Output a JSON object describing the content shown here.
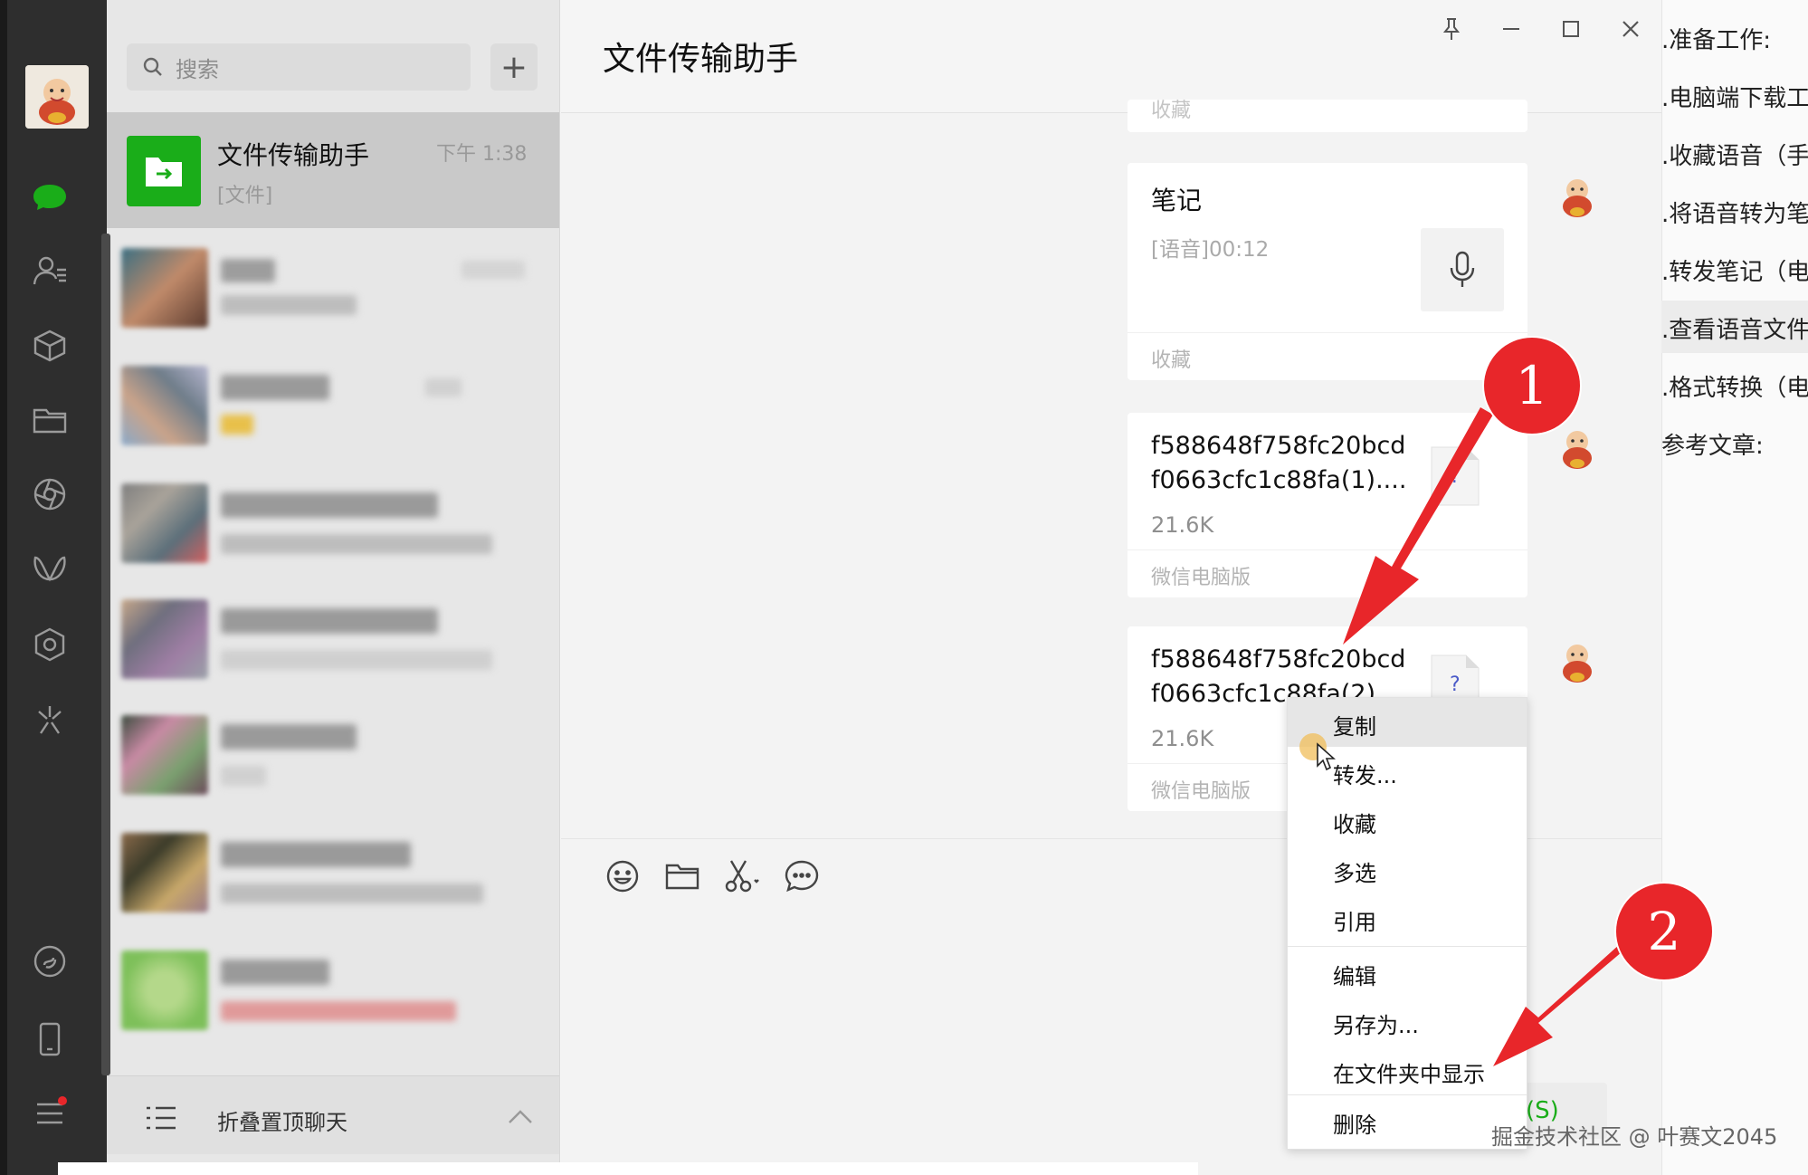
{
  "search": {
    "placeholder": "搜索",
    "icon": "search-icon"
  },
  "add_button_label": "+",
  "active_chat": {
    "name": "文件传输助手",
    "time": "下午 1:38",
    "preview": "[文件]"
  },
  "fold_label": "折叠置顶聊天",
  "chat": {
    "title": "文件传输助手",
    "top_partial_footer": "收藏",
    "note": {
      "title": "笔记",
      "voice": "[语音]00:12",
      "footer": "收藏"
    },
    "file1": {
      "name_line1": "f588648f758fc20bcd",
      "name_line2": "f0663cfc1c88fa(1)....",
      "size": "21.6K",
      "footer": "微信电脑版",
      "icon_char": "?"
    },
    "file2": {
      "name_line1": "f588648f758fc20bcd",
      "name_line2": "f0663cfc1c88fa(2)",
      "size": "21.6K",
      "footer": "微信电脑版",
      "icon_char": "?"
    }
  },
  "context_menu": [
    "复制",
    "转发...",
    "收藏",
    "多选",
    "引用",
    "编辑",
    "另存为...",
    "在文件夹中显示",
    "删除"
  ],
  "outline": [
    ".准备工作:",
    ".电脑端下载工",
    ".收藏语音（手",
    ".将语音转为笔",
    ".转发笔记（电",
    ".查看语音文件",
    ".格式转换（电",
    "参考文章:"
  ],
  "annotations": [
    "1",
    "2"
  ],
  "send_partial": "(S)",
  "watermark": "掘金技术社区 @ 叶赛文2045",
  "colors": {
    "wechat_green": "#1aad19",
    "badge_red": "#e8262a",
    "nav_dark": "#2e2e2e"
  }
}
